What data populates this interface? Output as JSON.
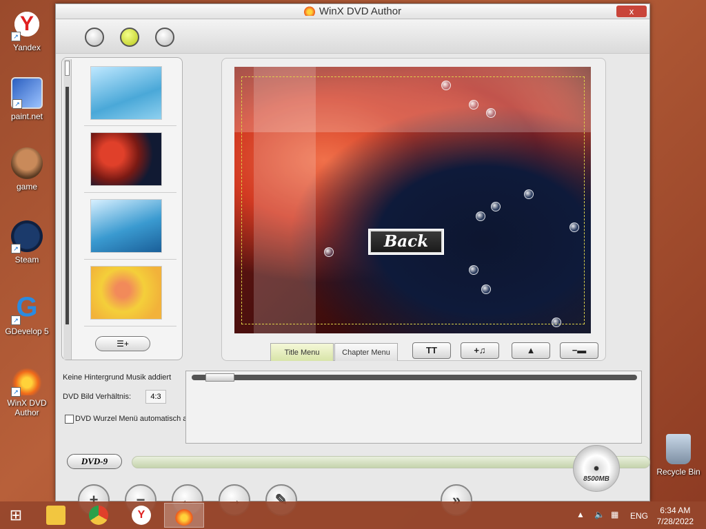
{
  "desktop": {
    "icons": [
      {
        "label": "Yandex",
        "icon": "yandex-icon"
      },
      {
        "label": "paint.net",
        "icon": "paintnet-icon"
      },
      {
        "label": "game",
        "icon": "game-icon"
      },
      {
        "label": "Steam",
        "icon": "steam-icon"
      },
      {
        "label": "GDevelop 5",
        "icon": "gdevelop-icon"
      },
      {
        "label": "WinX DVD Author",
        "icon": "winx-icon"
      },
      {
        "label": "Recycle Bin",
        "icon": "recycle-bin-icon"
      }
    ]
  },
  "window": {
    "title": "WinX DVD Author",
    "close_label": "x"
  },
  "preview": {
    "back_button_label": "Back"
  },
  "tabs": [
    {
      "label": "Title Menu",
      "active": true
    },
    {
      "label": "Chapter Menu",
      "active": false
    }
  ],
  "tools": {
    "text_label": "TT",
    "add_music_label": "+♫",
    "up_label": "▲",
    "remove_label": "−▬"
  },
  "settings": {
    "music_status": "Keine Hintergrund Musik addiert",
    "ratio_label": "DVD Bild Verhältnis:",
    "ratio_value": "4:3",
    "auto_root_menu_label": "DVD Wurzel Menü automatisch addieren",
    "auto_root_menu_checked": false
  },
  "disc": {
    "type_label": "DVD-9",
    "capacity": "8500MB"
  },
  "taskbar": {
    "language": "ENG",
    "time": "6:34 AM",
    "date": "7/28/2022"
  }
}
